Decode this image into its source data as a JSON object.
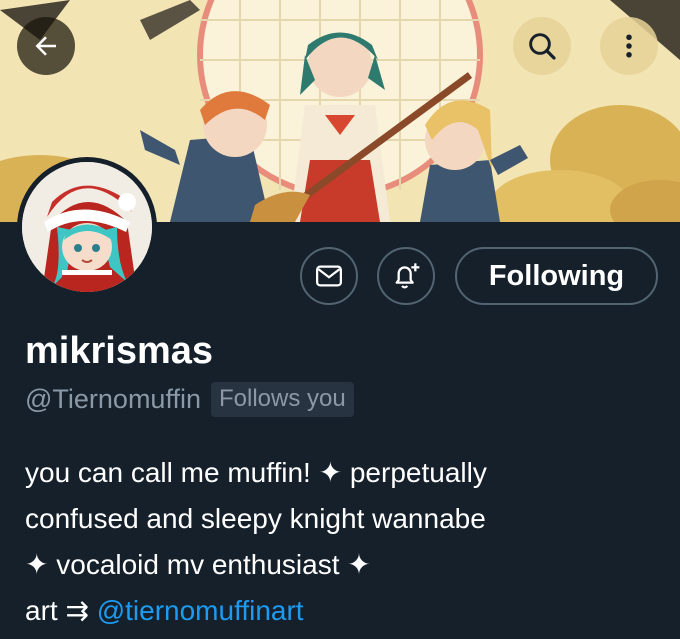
{
  "header": {
    "back_icon": "arrow-left-icon",
    "search_icon": "search-icon",
    "more_icon": "more-vertical-icon"
  },
  "actions": {
    "message_icon": "mail-icon",
    "notify_icon": "bell-plus-icon",
    "following_label": "Following"
  },
  "profile": {
    "display_name": "mikrismas",
    "handle": "@Tiernomuffin",
    "follows_you_badge": "Follows you",
    "bio": {
      "line1": "you can call me muffin! ✦ perpetually",
      "line2": "confused and sleepy knight wannabe",
      "line3": "✦ vocaloid mv enthusiast ✦",
      "line4_prefix": "art ⇉ ",
      "line4_link": "@tiernomuffinart"
    }
  },
  "colors": {
    "background": "#15202b",
    "text_primary": "#ffffff",
    "text_secondary": "#8b98a5",
    "link": "#1d9bf0",
    "border": "#536471",
    "badge_bg": "#273340"
  }
}
